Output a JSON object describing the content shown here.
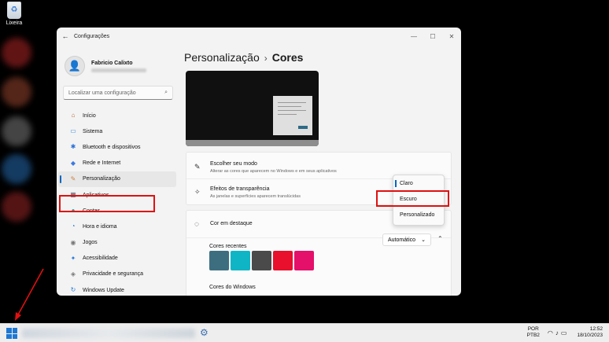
{
  "desktop": {
    "recycle_bin_label": "Lixeira"
  },
  "window": {
    "title": "Configurações",
    "controls": {
      "minimize": "—",
      "maximize": "☐",
      "close": "✕"
    }
  },
  "profile": {
    "name": "Fabricio Calixto"
  },
  "search": {
    "placeholder": "Localizar uma configuração",
    "icon": "search-icon"
  },
  "sidebar": {
    "items": [
      {
        "label": "Início",
        "icon": "home-icon",
        "glyph": "⌂",
        "color": "#c06030"
      },
      {
        "label": "Sistema",
        "icon": "monitor-icon",
        "glyph": "▭",
        "color": "#2a8ad6"
      },
      {
        "label": "Bluetooth e dispositivos",
        "icon": "bluetooth-icon",
        "glyph": "✱",
        "color": "#2a6fd6"
      },
      {
        "label": "Rede e Internet",
        "icon": "wifi-icon",
        "glyph": "◆",
        "color": "#3c7ae0"
      },
      {
        "label": "Personalização",
        "icon": "brush-icon",
        "glyph": "✎",
        "color": "#d08040",
        "active": true
      },
      {
        "label": "Aplicativos",
        "icon": "apps-icon",
        "glyph": "▦",
        "color": "#5a5a6a"
      },
      {
        "label": "Contas",
        "icon": "accounts-icon",
        "glyph": "●",
        "color": "#2ea0a0"
      },
      {
        "label": "Hora e idioma",
        "icon": "globe-clock-icon",
        "glyph": "◔",
        "color": "#2a7ad6"
      },
      {
        "label": "Jogos",
        "icon": "gamepad-icon",
        "glyph": "◉",
        "color": "#777777"
      },
      {
        "label": "Acessibilidade",
        "icon": "accessibility-icon",
        "glyph": "✦",
        "color": "#2a7ad6"
      },
      {
        "label": "Privacidade e segurança",
        "icon": "shield-icon",
        "glyph": "◈",
        "color": "#777777"
      },
      {
        "label": "Windows Update",
        "icon": "update-icon",
        "glyph": "↻",
        "color": "#2a7ad6"
      }
    ]
  },
  "breadcrumb": {
    "parent": "Personalização",
    "separator": "›",
    "current": "Cores"
  },
  "mode_row": {
    "icon": "brush-icon",
    "title": "Escolher seu modo",
    "subtitle": "Alterar as cores que aparecem no Windows e em seus aplicativos",
    "options": [
      "Claro",
      "Escuro",
      "Personalizado"
    ],
    "selected": "Claro"
  },
  "transparency_row": {
    "icon": "sparkle-icon",
    "title": "Efeitos de transparência",
    "subtitle": "As janelas e superfícies aparecem translúcidas"
  },
  "accent_row": {
    "icon": "palette-icon",
    "title": "Cor em destaque",
    "value": "Automático",
    "recent_label": "Cores recentes",
    "recent_colors": [
      "#3d6e80",
      "#10b5c5",
      "#4a4a4a",
      "#e8102c",
      "#e4106a"
    ],
    "windows_label": "Cores do Windows",
    "windows_colors": [
      "#f2b600",
      "#f08c00",
      "#e06a00",
      "#d65a00",
      "#d04a10",
      "#d83b20",
      "#e0402c",
      "#d4322a",
      "#c42b48",
      "#e4106a"
    ]
  },
  "taskbar": {
    "language": "POR",
    "layout": "PTB2",
    "time": "12:52",
    "date": "18/10/2023"
  }
}
